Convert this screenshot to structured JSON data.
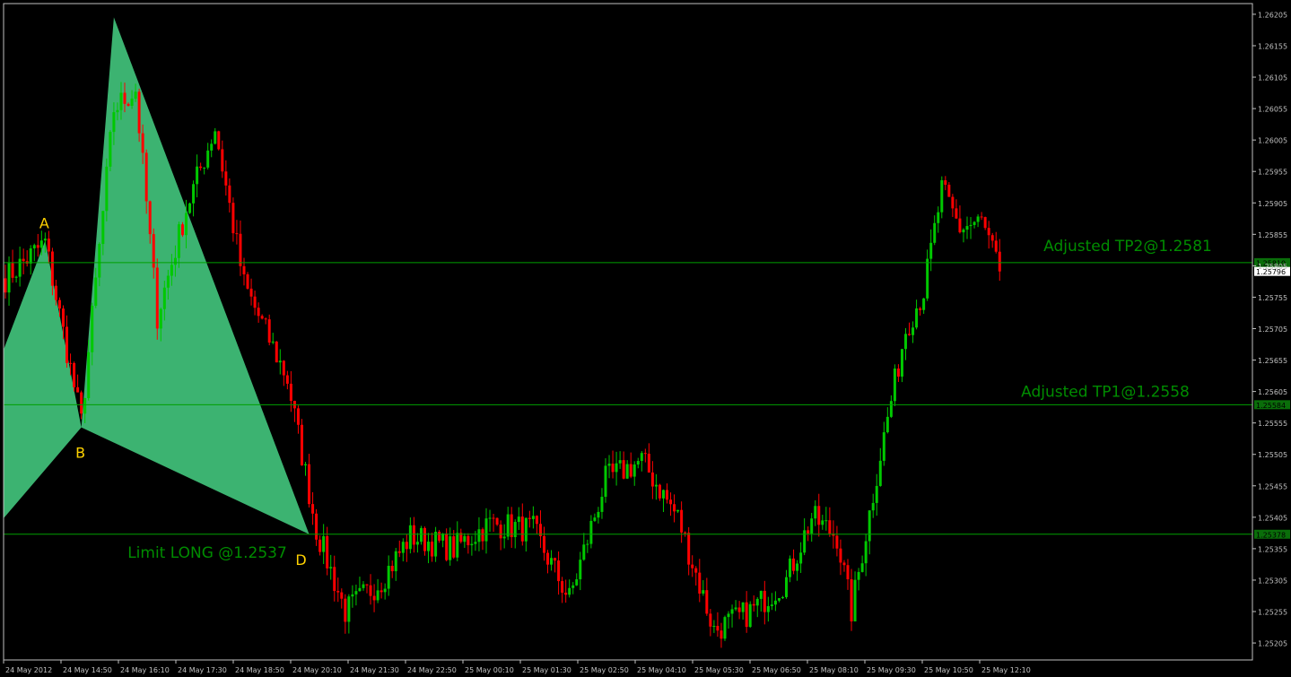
{
  "chart_data": {
    "type": "candlestick",
    "title": "",
    "xlabel": "",
    "ylabel": "",
    "ylim": [
      1.25178,
      1.26222
    ],
    "grid": false,
    "y_ticks": [
      "1.26205",
      "1.26155",
      "1.26105",
      "1.26055",
      "1.26005",
      "1.25955",
      "1.25905",
      "1.25855",
      "1.25805",
      "1.25755",
      "1.25705",
      "1.25655",
      "1.25605",
      "1.25555",
      "1.25505",
      "1.25455",
      "1.25405",
      "1.25355",
      "1.25305",
      "1.25255",
      "1.25205"
    ],
    "x_ticks": [
      "24 May 2012",
      "24 May 14:50",
      "24 May 16:10",
      "24 May 17:30",
      "24 May 18:50",
      "24 May 20:10",
      "24 May 21:30",
      "24 May 22:50",
      "25 May 00:10",
      "25 May 01:30",
      "25 May 02:50",
      "25 May 04:10",
      "25 May 05:30",
      "25 May 06:50",
      "25 May 08:10",
      "25 May 09:30",
      "25 May 10:50",
      "25 May 12:10"
    ],
    "bar_count": 276,
    "price_path": [
      {
        "bar": 0,
        "price": 1.25785
      },
      {
        "bar": 11,
        "price": 1.25842
      },
      {
        "bar": 21,
        "price": 1.25556
      },
      {
        "bar": 30,
        "price": 1.26055
      },
      {
        "bar": 36,
        "price": 1.26085
      },
      {
        "bar": 42,
        "price": 1.25725
      },
      {
        "bar": 50,
        "price": 1.25895
      },
      {
        "bar": 58,
        "price": 1.26025
      },
      {
        "bar": 66,
        "price": 1.25775
      },
      {
        "bar": 78,
        "price": 1.25625
      },
      {
        "bar": 86,
        "price": 1.25385
      },
      {
        "bar": 94,
        "price": 1.25255
      },
      {
        "bar": 104,
        "price": 1.25305
      },
      {
        "bar": 112,
        "price": 1.25375
      },
      {
        "bar": 124,
        "price": 1.25355
      },
      {
        "bar": 134,
        "price": 1.25395
      },
      {
        "bar": 146,
        "price": 1.25385
      },
      {
        "bar": 156,
        "price": 1.25275
      },
      {
        "bar": 166,
        "price": 1.25465
      },
      {
        "bar": 176,
        "price": 1.25495
      },
      {
        "bar": 186,
        "price": 1.25405
      },
      {
        "bar": 196,
        "price": 1.25225
      },
      {
        "bar": 206,
        "price": 1.25255
      },
      {
        "bar": 216,
        "price": 1.25305
      },
      {
        "bar": 223,
        "price": 1.25405
      },
      {
        "bar": 230,
        "price": 1.25375
      },
      {
        "bar": 234,
        "price": 1.25255
      },
      {
        "bar": 242,
        "price": 1.25505
      },
      {
        "bar": 249,
        "price": 1.25705
      },
      {
        "bar": 254,
        "price": 1.25765
      },
      {
        "bar": 259,
        "price": 1.25925
      },
      {
        "bar": 264,
        "price": 1.25865
      },
      {
        "bar": 270,
        "price": 1.25875
      },
      {
        "bar": 275,
        "price": 1.25796
      }
    ],
    "harmonic_pattern": {
      "points": [
        {
          "label": "A",
          "bar": 11,
          "price": 1.25845
        },
        {
          "label": "B",
          "bar": 21,
          "price": 1.25548
        },
        {
          "label": "C",
          "bar": 30,
          "price": 1.262
        },
        {
          "label": "D",
          "bar": 84,
          "price": 1.25378
        }
      ],
      "fill": "#3cb371"
    },
    "levels": [
      {
        "label": "Adjusted TP2@1.2581",
        "price": 1.2581,
        "tag": "1.25810"
      },
      {
        "label": "Adjusted TP1@1.2558",
        "price": 1.25584,
        "tag": "1.25584"
      },
      {
        "label": "Limit LONG @1.2537",
        "price": 1.25378,
        "tag": "1.25378"
      }
    ],
    "current_price": {
      "value": 1.25796,
      "tag": "1.25796"
    },
    "colors": {
      "background": "#000000",
      "bull_candle": "#00c800",
      "bear_candle": "#ff0000",
      "level_line": "#00a000",
      "level_text": "#008c00",
      "pattern_label": "#ffd200",
      "axis": "#c0c0c0"
    }
  }
}
